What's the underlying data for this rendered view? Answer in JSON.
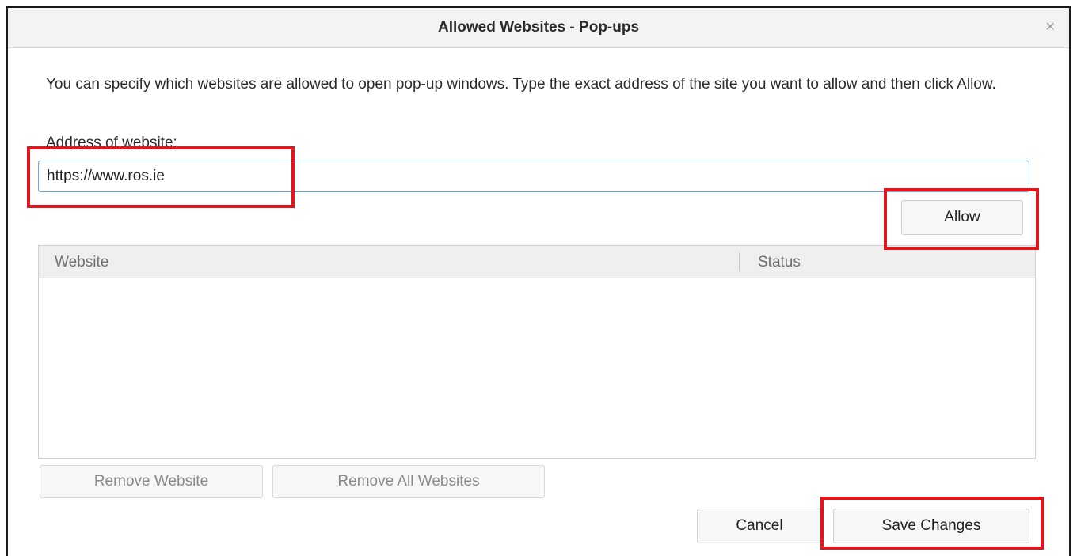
{
  "dialog": {
    "title": "Allowed Websites - Pop-ups",
    "close_glyph": "×",
    "description": "You can specify which websites are allowed to open pop-up windows. Type the exact address of the site you want to allow and then click Allow.",
    "address_label": "Address of website:",
    "address_value": "https://www.ros.ie",
    "allow_label": "Allow",
    "table": {
      "columns": [
        "Website",
        "Status"
      ],
      "rows": []
    },
    "remove_website_label": "Remove Website",
    "remove_all_label": "Remove All Websites",
    "cancel_label": "Cancel",
    "save_label": "Save Changes"
  },
  "colors": {
    "highlight": "#e3141c",
    "input_focus_border": "#6fa2e0"
  }
}
